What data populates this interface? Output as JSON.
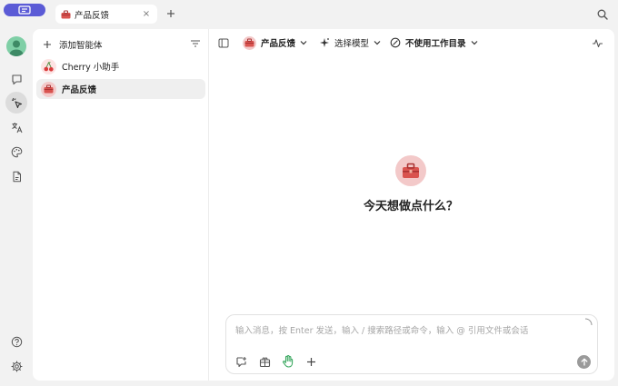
{
  "tabs": [
    {
      "label": "产品反馈",
      "close": "×"
    }
  ],
  "tab_add": "+",
  "sidebar": {
    "add_agent_label": "添加智能体",
    "items": [
      {
        "label": "Cherry 小助手",
        "icon": "cherry-icon"
      },
      {
        "label": "产品反馈",
        "icon": "toolbox-icon",
        "selected": true
      }
    ]
  },
  "toolbar": {
    "agent_label": "产品反馈",
    "model_label": "选择模型",
    "workdir_label": "不使用工作目录"
  },
  "welcome": {
    "title": "今天想做点什么？"
  },
  "composer": {
    "placeholder": "输入消息，按 Enter 发送，输入 / 搜索路径或命令，输入 @ 引用文件或会话",
    "value": ""
  },
  "colors": {
    "accent": "#5b5bd6",
    "avatar_green": "#7fcfa6",
    "agent_red": "#d9534f",
    "active_hand": "#3aa860"
  }
}
